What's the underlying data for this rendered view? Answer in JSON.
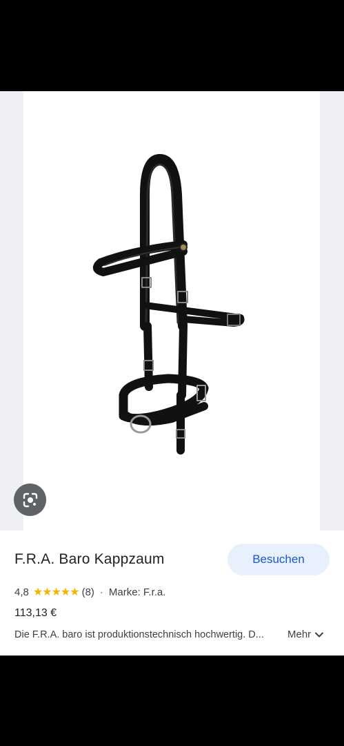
{
  "product": {
    "title": "F.R.A. Baro Kappzaum",
    "rating": "4,8",
    "stars": "★★★★★",
    "review_count": "(8)",
    "separator": "·",
    "brand": "Marke: F.r.a.",
    "price": "113,13 €",
    "description": "Die F.R.A. baro ist produktionstechnisch hochwertig. D...",
    "more_label": "Mehr"
  },
  "actions": {
    "visit_label": "Besuchen"
  },
  "icons": {
    "lens": "google-lens-icon",
    "chevron": "chevron-down-icon"
  },
  "colors": {
    "visit_bg": "#e8f0fe",
    "visit_text": "#1a56c4",
    "star": "#f4b400"
  }
}
